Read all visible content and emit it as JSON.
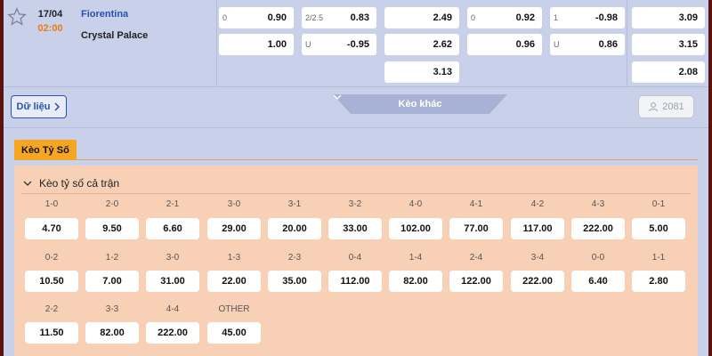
{
  "match": {
    "date": "17/04",
    "time": "02:00",
    "home_team": "Fiorentina",
    "away_team": "Crystal Palace",
    "odds_row1": [
      {
        "hcap": "0",
        "value": "0.90"
      },
      {
        "hcap": "2/2.5",
        "value": "0.83"
      },
      {
        "hcap": "",
        "value": "2.49"
      },
      {
        "hcap": "0",
        "value": "0.92"
      },
      {
        "hcap": "1",
        "value": "-0.98"
      },
      {
        "hcap": "",
        "value": "3.09"
      }
    ],
    "odds_row2": [
      {
        "hcap": "",
        "value": "1.00"
      },
      {
        "hcap": "U",
        "value": "-0.95"
      },
      {
        "hcap": "",
        "value": "2.62"
      },
      {
        "hcap": "",
        "value": "0.96"
      },
      {
        "hcap": "U",
        "value": "0.86"
      },
      {
        "hcap": "",
        "value": "3.15"
      }
    ],
    "odds_row3": [
      {
        "hcap": "",
        "value": "3.13"
      },
      {
        "hcap": "",
        "value": "2.08"
      }
    ]
  },
  "actions": {
    "data_label": "Dữ liệu",
    "more_label": "Kèo khác",
    "count": "2081"
  },
  "tab": {
    "label": "Kèo Tỷ Số"
  },
  "panel": {
    "title": "Kèo tỷ số cả trận",
    "scores": [
      {
        "label": "1-0",
        "odds": "4.70"
      },
      {
        "label": "2-0",
        "odds": "9.50"
      },
      {
        "label": "2-1",
        "odds": "6.60"
      },
      {
        "label": "3-0",
        "odds": "29.00"
      },
      {
        "label": "3-1",
        "odds": "20.00"
      },
      {
        "label": "3-2",
        "odds": "33.00"
      },
      {
        "label": "4-0",
        "odds": "102.00"
      },
      {
        "label": "4-1",
        "odds": "77.00"
      },
      {
        "label": "4-2",
        "odds": "117.00"
      },
      {
        "label": "4-3",
        "odds": "222.00"
      },
      {
        "label": "0-1",
        "odds": "5.00"
      },
      {
        "label": "0-2",
        "odds": "10.50"
      },
      {
        "label": "1-2",
        "odds": "7.00"
      },
      {
        "label": "3-0",
        "odds": "31.00"
      },
      {
        "label": "1-3",
        "odds": "22.00"
      },
      {
        "label": "2-3",
        "odds": "35.00"
      },
      {
        "label": "0-4",
        "odds": "112.00"
      },
      {
        "label": "1-4",
        "odds": "82.00"
      },
      {
        "label": "2-4",
        "odds": "122.00"
      },
      {
        "label": "3-4",
        "odds": "222.00"
      },
      {
        "label": "0-0",
        "odds": "6.40"
      },
      {
        "label": "1-1",
        "odds": "2.80"
      },
      {
        "label": "2-2",
        "odds": "11.50"
      },
      {
        "label": "3-3",
        "odds": "82.00"
      },
      {
        "label": "4-4",
        "odds": "222.00"
      },
      {
        "label": "OTHER",
        "odds": "45.00"
      }
    ]
  },
  "colors": {
    "accent_blue": "#2b4fb4",
    "accent_orange": "#f5a623",
    "time_orange": "#f07a10",
    "panel_bg": "#f8d0b6",
    "row_bg": "#c8d0ea"
  }
}
